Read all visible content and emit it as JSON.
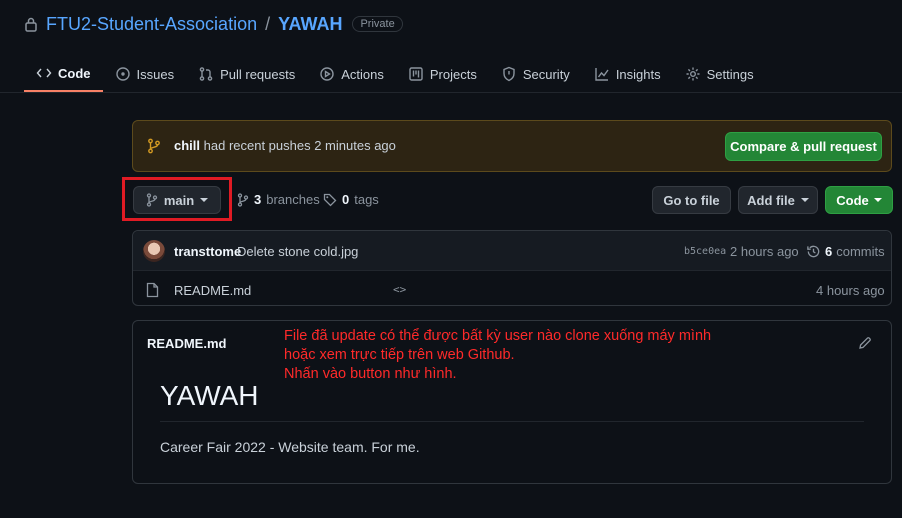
{
  "repo": {
    "owner": "FTU2-Student-Association",
    "separator": "/",
    "name": "YAWAH",
    "visibility": "Private"
  },
  "tabs": [
    {
      "label": "Code",
      "icon": "code-icon"
    },
    {
      "label": "Issues",
      "icon": "issue-icon"
    },
    {
      "label": "Pull requests",
      "icon": "pull-request-icon"
    },
    {
      "label": "Actions",
      "icon": "play-icon"
    },
    {
      "label": "Projects",
      "icon": "project-icon"
    },
    {
      "label": "Security",
      "icon": "shield-icon"
    },
    {
      "label": "Insights",
      "icon": "graph-icon"
    },
    {
      "label": "Settings",
      "icon": "gear-icon"
    }
  ],
  "flash": {
    "branch": "chill",
    "message": "had recent pushes 2 minutes ago",
    "button": "Compare & pull request"
  },
  "branch_bar": {
    "current_branch": "main",
    "branches_count": "3",
    "branches_label": "branches",
    "tags_count": "0",
    "tags_label": "tags",
    "go_to_file": "Go to file",
    "add_file": "Add file",
    "code": "Code"
  },
  "latest_commit": {
    "author": "transttome",
    "message": "Delete stone cold.jpg",
    "sha": "b5ce0ea",
    "time": "2 hours ago",
    "commits_count": "6",
    "commits_label": "commits"
  },
  "files": [
    {
      "name": "README.md",
      "code_hint": "<>",
      "time": "4 hours ago"
    }
  ],
  "readme": {
    "label": "README.md",
    "heading": "YAWAH",
    "body": "Career Fair 2022 - Website team. For me."
  },
  "annotation": {
    "line1": "File đã update có thể được bất kỳ user nào clone xuống máy mình",
    "line2": "hoặc xem trực tiếp trên web Github.",
    "line3": "Nhấn vào button như hình."
  },
  "colors": {
    "accent_tab": "#f78166",
    "link": "#58a6ff",
    "green_button": "#238636",
    "annotation": "#ff2a2a",
    "highlight_frame": "#e01b24"
  }
}
